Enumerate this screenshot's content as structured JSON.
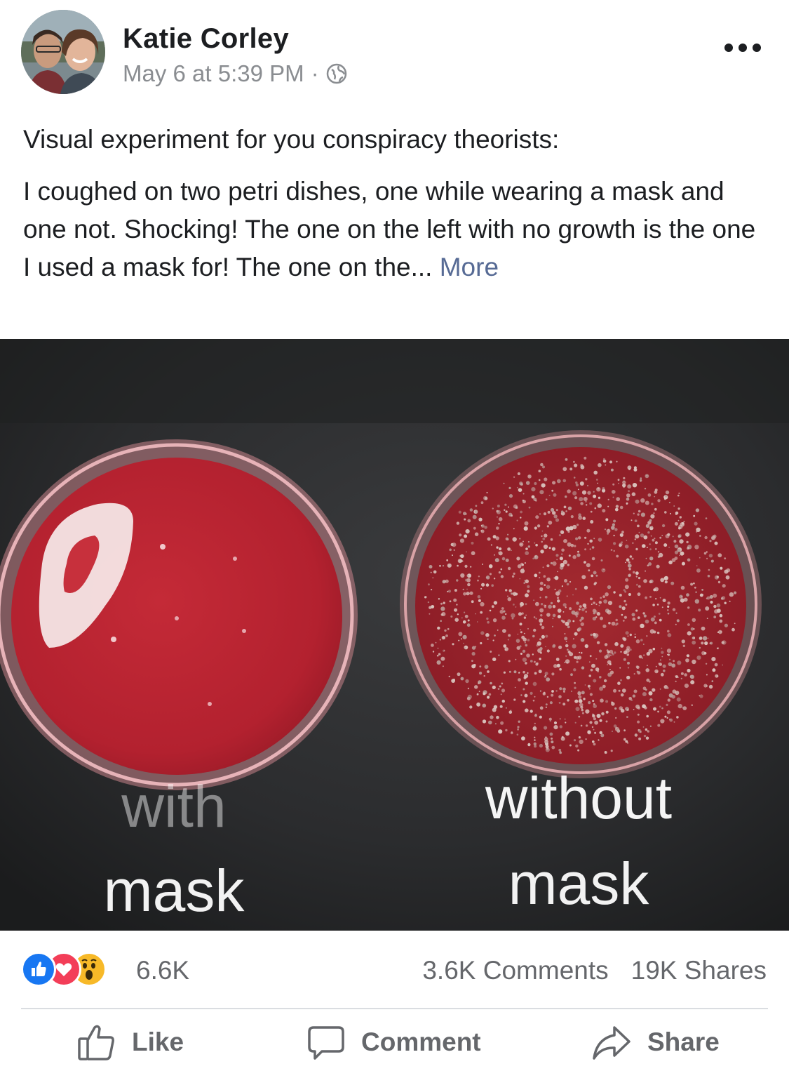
{
  "post": {
    "author": "Katie Corley",
    "timestamp": "May 6 at 5:39 PM",
    "separator": "·",
    "privacy_icon": "globe-icon",
    "menu_icon": "more-options-icon",
    "paragraphs": [
      "Visual experiment for you conspiracy theorists:",
      "I coughed on two petri dishes, one while wearing a mask and one not. Shocking! The one on the left with no growth is the one I used a mask for! The one on the..."
    ],
    "more_label": "More"
  },
  "photo": {
    "left_label_line1": "with",
    "left_label_line2": "mask",
    "right_label_line1": "without",
    "right_label_line2": "mask",
    "agar_color": "#b3212f",
    "agar_color_dark": "#8d1d27",
    "background_color": "#2b2c2e"
  },
  "reactions": {
    "icons": [
      "like-reaction-icon",
      "love-reaction-icon",
      "wow-reaction-icon"
    ],
    "count": "6.6K",
    "comments": "3.6K Comments",
    "shares": "19K Shares"
  },
  "actions": {
    "like_label": "Like",
    "comment_label": "Comment",
    "share_label": "Share"
  },
  "colors": {
    "like_blue": "#1877f2",
    "love_red": "#f33e58",
    "wow_yellow": "#f7b928",
    "link": "#576b95",
    "muted": "#65676b"
  }
}
